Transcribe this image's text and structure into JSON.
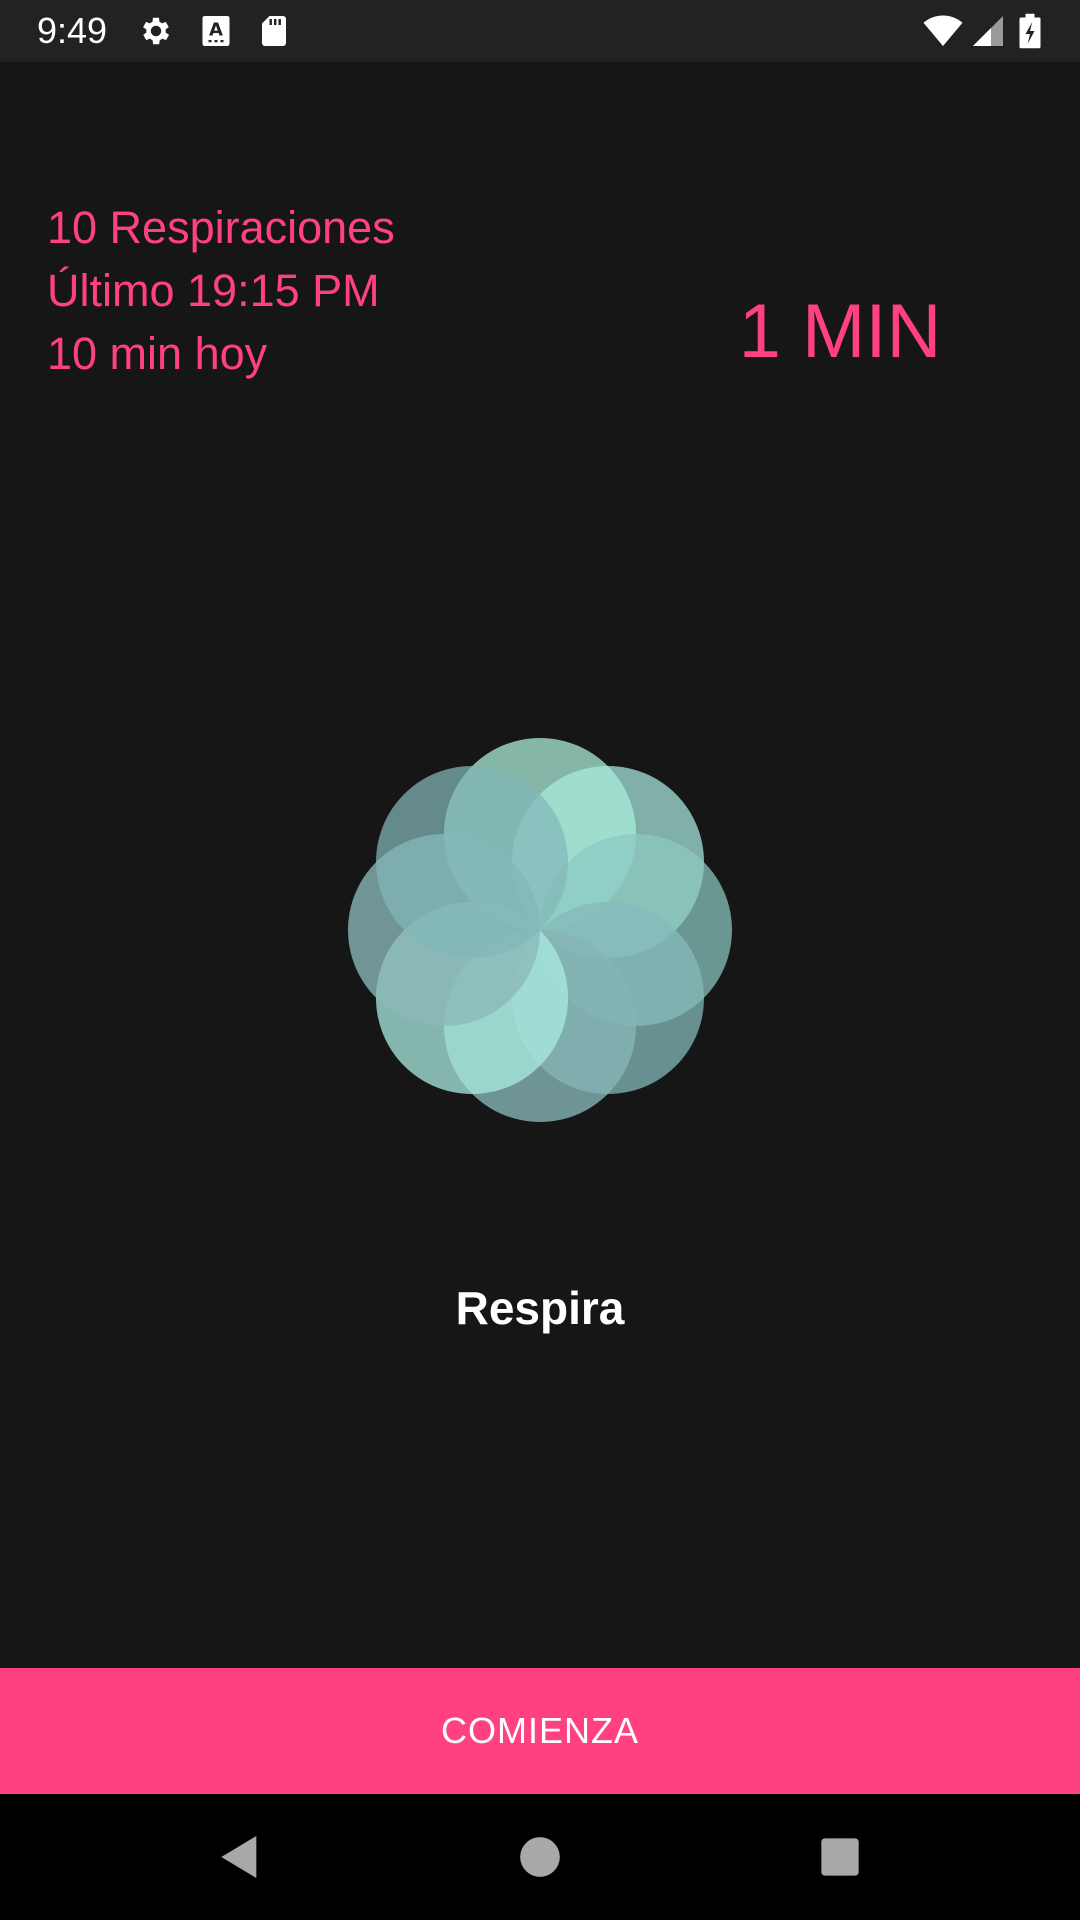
{
  "status_bar": {
    "time": "9:49",
    "left_icons": [
      "gear-icon",
      "a-keyboard-icon",
      "sd-card-icon"
    ],
    "right_icons": [
      "wifi-icon",
      "cell-signal-icon",
      "battery-charging-icon"
    ]
  },
  "stats": {
    "breaths": "10 Respiraciones",
    "last": "Último 19:15 PM",
    "today": "10 min hoy"
  },
  "duration": "1 MIN",
  "breathe_label": "Respira",
  "start_button_label": "COMIENZA",
  "nav_bar": {
    "icons": [
      "back-icon",
      "home-icon",
      "recents-icon"
    ]
  },
  "colors": {
    "accent": "#ff4081",
    "background": "#161616",
    "flower": "#7fd6c6"
  }
}
